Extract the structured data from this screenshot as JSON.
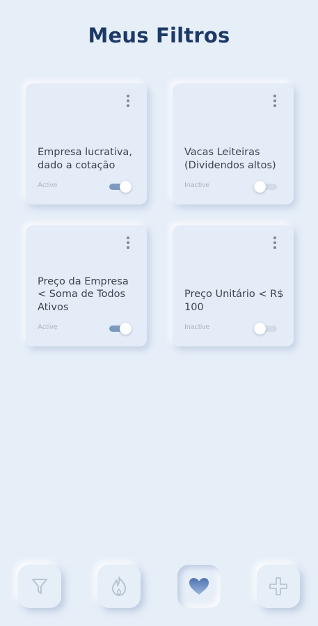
{
  "header": {
    "title": "Meus Filtros"
  },
  "filters": [
    {
      "title": "Empresa lucrativa, dado a cotação",
      "status": "Active",
      "enabled": true
    },
    {
      "title": "Vacas Leiteiras (Dividendos altos)",
      "status": "Inactive",
      "enabled": false
    },
    {
      "title": "Preço da Empresa < Soma de Todos Ativos",
      "status": "Active",
      "enabled": true
    },
    {
      "title": "Preço Unitário < R$ 100",
      "status": "Inactive",
      "enabled": false
    }
  ],
  "bottom_nav": {
    "items": [
      {
        "icon": "filter-icon",
        "active": false
      },
      {
        "icon": "flame-icon",
        "active": false
      },
      {
        "icon": "heart-icon",
        "active": true
      },
      {
        "icon": "plus-icon",
        "active": false
      }
    ]
  },
  "colors": {
    "background": "#e6eef8",
    "title": "#1d3a66",
    "toggle_on": "#7d99c0",
    "heart": "#6f90c4"
  }
}
